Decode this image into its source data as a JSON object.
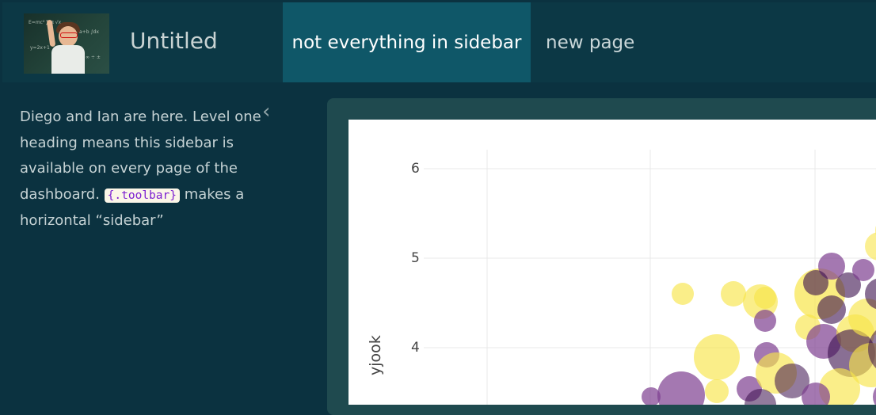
{
  "header": {
    "title": "Untitled",
    "tabs": [
      {
        "label": "not everything in sidebar",
        "active": true
      },
      {
        "label": "new page",
        "active": false
      }
    ]
  },
  "sidebar": {
    "text_before_code": "Diego and Ian are here. Level one heading means this sidebar is available on every page of the dashboard. ",
    "code": "{.toolbar}",
    "text_after_code": " makes a horizontal “sidebar”",
    "collapse_icon": "chevron-left-icon"
  },
  "chart_data": {
    "type": "scatter",
    "y_ticks": [
      "6",
      "5",
      "4"
    ],
    "ylabel": "yjook",
    "grid": true,
    "colors": [
      "#f8e54a",
      "#7d3f90",
      "#3b0f4c"
    ]
  }
}
